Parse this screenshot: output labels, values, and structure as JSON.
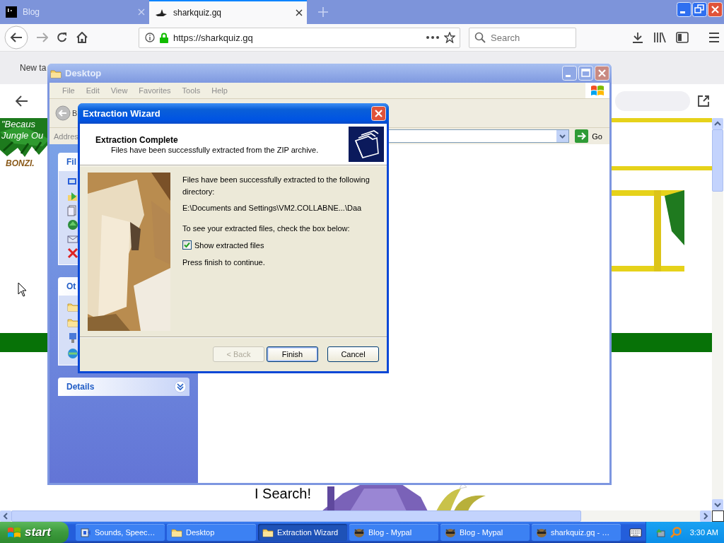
{
  "browser": {
    "tabs": [
      {
        "label": "Blog",
        "selected": false
      },
      {
        "label": "sharkquiz.gq",
        "selected": true
      }
    ],
    "url": "https://sharkquiz.gq",
    "search": {
      "placeholder": "Search"
    }
  },
  "web_page": {
    "tab_bar_text": "New ta",
    "banner_lines": [
      "\"Becaus",
      "Jungle Ou"
    ],
    "banner_logo": "BONZI.",
    "caption": "I Search!"
  },
  "explorer": {
    "title": "Desktop",
    "menu": [
      "File",
      "Edit",
      "View",
      "Favorites",
      "Tools",
      "Help"
    ],
    "toolbar_text": "B",
    "address_label": "Addres",
    "go_button": "Go",
    "task_panes": [
      {
        "title": "Fil",
        "expanded": true
      },
      {
        "title": "Ot",
        "expanded": true
      },
      {
        "title": "Details",
        "expanded": false
      }
    ]
  },
  "wizard": {
    "title": "Extraction Wizard",
    "heading": "Extraction Complete",
    "subheading": "Files have been successfully extracted from the ZIP archive.",
    "message": "Files have been successfully extracted to the following directory:",
    "path": "E:\\Documents and Settings\\VM2.COLLABNE...\\Daa",
    "instruction": "To see your extracted files, check the box below:",
    "checkbox": {
      "label": "Show extracted files",
      "checked": true
    },
    "footer_note": "Press finish to continue.",
    "buttons": [
      {
        "label": "< Back",
        "disabled": true,
        "default": false
      },
      {
        "label": "Finish",
        "disabled": false,
        "default": true
      },
      {
        "label": "Cancel",
        "disabled": false,
        "default": false
      }
    ]
  },
  "taskbar": {
    "start": "start",
    "items": [
      {
        "label": "Sounds, Speec…",
        "kind": "app",
        "selected": false
      },
      {
        "label": "Desktop",
        "kind": "folder",
        "selected": false
      },
      {
        "label": "Extraction Wizard",
        "kind": "folder",
        "selected": true
      },
      {
        "label": "Blog - Mypal",
        "kind": "browser",
        "selected": false
      },
      {
        "label": "Blog - Mypal",
        "kind": "browser",
        "selected": false
      },
      {
        "label": "sharkquiz.gq - …",
        "kind": "browser",
        "selected": false
      }
    ],
    "clock": "3:30 AM"
  }
}
